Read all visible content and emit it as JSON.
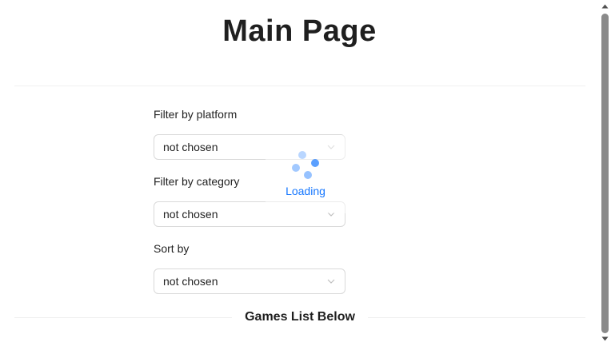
{
  "page": {
    "title": "Main Page"
  },
  "filters": {
    "platform": {
      "label": "Filter by platform",
      "value": "not chosen"
    },
    "category": {
      "label": "Filter by category",
      "value": "not chosen"
    },
    "sort": {
      "label": "Sort by",
      "value": "not chosen"
    }
  },
  "loading": {
    "text": "Loading"
  },
  "games": {
    "divider_text": "Games List Below"
  },
  "colors": {
    "accent": "#1677ff",
    "border": "#d9d9d9"
  }
}
